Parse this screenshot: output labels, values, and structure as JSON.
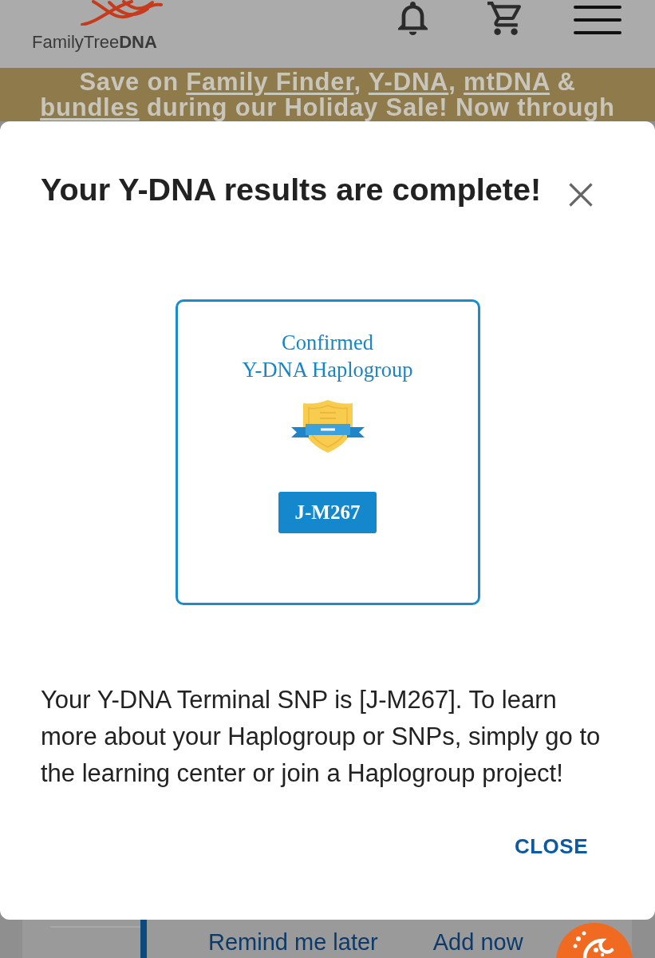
{
  "header": {
    "logo": "FamilyTree**DNA**"
  },
  "promo_banner": {
    "lines": [
      [
        {
          "text": "Save on ",
          "link": false
        },
        {
          "text": "Family Finder",
          "link": true
        },
        {
          "text": ", ",
          "link": false
        },
        {
          "text": "Y-DNA",
          "link": true
        },
        {
          "text": ", ",
          "link": false
        },
        {
          "text": "mtDNA",
          "link": true
        },
        {
          "text": " &",
          "link": false
        }
      ],
      [
        {
          "text": "bundles",
          "link": true
        },
        {
          "text": " during our Holiday Sale! Now through",
          "link": false
        }
      ]
    ]
  },
  "dialog": {
    "title": "Your Y-DNA results are complete!",
    "badge": {
      "heading": [
        "Confirmed",
        "Y-DNA Haplogroup"
      ],
      "haplogroup": "J-M267"
    },
    "message": "Your Y-DNA Terminal SNP is [J-M267]. To learn more about your Haplogroup or SNPs, simply go to the learning center or join a Haplogroup project!",
    "buttons": [
      "CLOSE"
    ]
  },
  "background_card": {
    "actions": [
      "Remind me later",
      "Add now"
    ]
  }
}
